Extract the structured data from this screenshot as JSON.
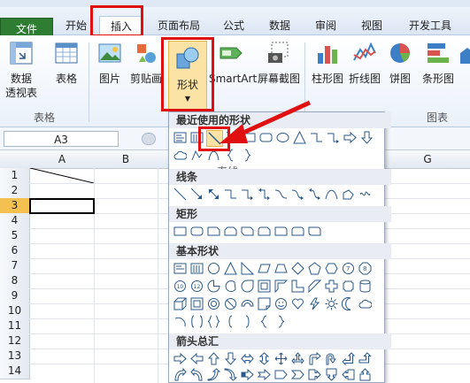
{
  "tabs": {
    "file": "文件",
    "home": "开始",
    "insert": "插入",
    "layout": "页面布局",
    "formula": "公式",
    "data": "数据",
    "review": "审阅",
    "view": "视图",
    "developer": "开发工具"
  },
  "ribbon": {
    "pivot_label_1": "数据",
    "pivot_label_2": "透视表",
    "table": "表格",
    "picture": "图片",
    "clipart": "剪贴画",
    "shapes": "形状",
    "smartart": "SmartArt",
    "screenshot": "屏幕截图",
    "column_chart": "柱形图",
    "line_chart": "折线图",
    "pie_chart": "饼图",
    "bar_chart": "条形图",
    "group_tables": "表格",
    "group_charts": "图表"
  },
  "formula_bar": {
    "namebox": "A3"
  },
  "grid": {
    "columns": [
      "A",
      "B",
      "G"
    ],
    "rows": [
      "1",
      "2",
      "3",
      "4",
      "5",
      "6",
      "7",
      "8",
      "9",
      "10",
      "11",
      "12",
      "13",
      "14"
    ],
    "selected_row": "3"
  },
  "dropdown": {
    "sections": {
      "recent": "最近使用的形状",
      "lines": "线条",
      "rect": "矩形",
      "basic": "基本形状",
      "arrows": "箭头总汇"
    },
    "tooltip": "直线"
  },
  "colors": {
    "accent_red": "#e01010",
    "file_tab": "#2e7d32"
  }
}
